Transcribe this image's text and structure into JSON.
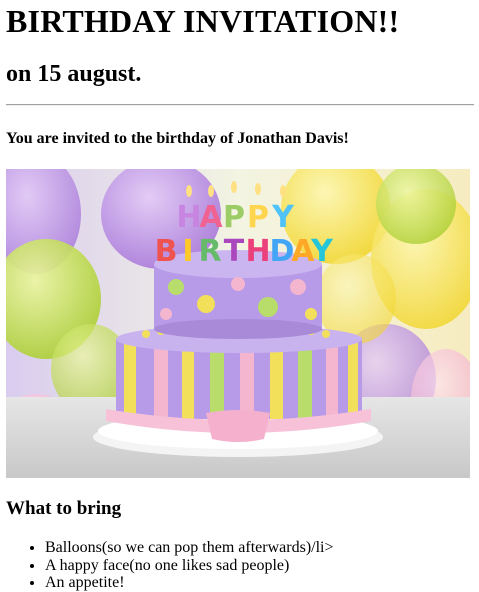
{
  "header": {
    "title": "BIRTHDAY INVITATION!!",
    "date": "on 15 august."
  },
  "invite": {
    "text": "You are invited to the birthday of Jonathan Davis!"
  },
  "photo": {
    "cake_letters": "HAPPY BIRTHDAY"
  },
  "bring": {
    "heading": "What to bring",
    "items": [
      "Balloons(so we can pop them afterwards)/li>",
      "A happy face(no one likes sad people)",
      "An appetite!"
    ]
  },
  "colors": {
    "balloon_purple": "#b98ee2",
    "balloon_green": "#c7e04a",
    "balloon_yellow": "#f5e84a",
    "balloon_pink": "#f5b9d8",
    "cake_lilac": "#b79be8",
    "cake_pink": "#f4b6cf",
    "cake_yellow": "#f3e05a",
    "cake_green": "#b8dd6a"
  }
}
